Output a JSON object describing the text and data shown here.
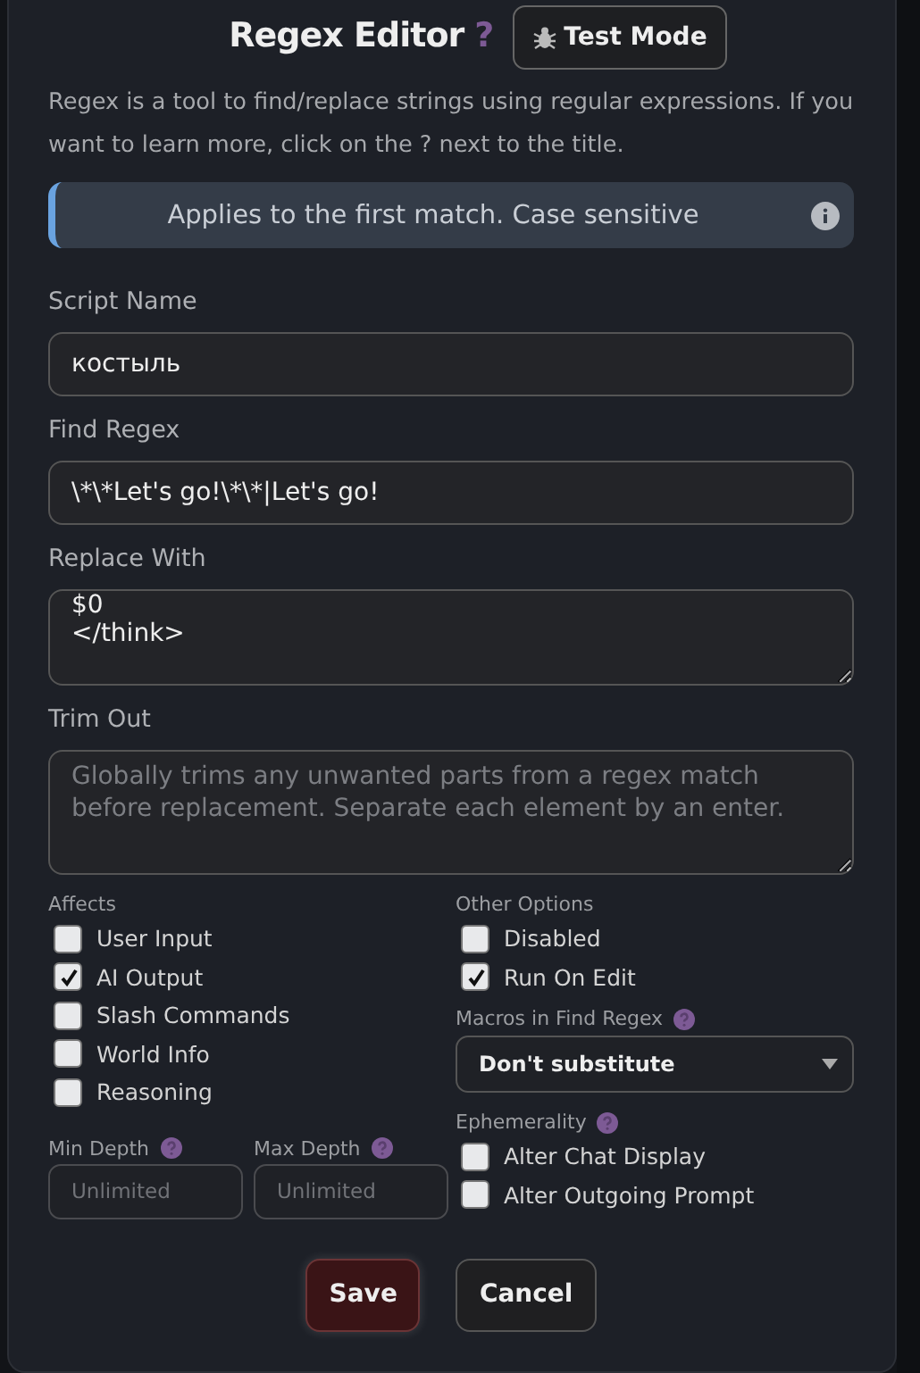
{
  "title": "Regex Editor",
  "help_mark": "?",
  "test_mode": {
    "label": "Test Mode"
  },
  "description": "Regex is a tool to find/replace strings using regular expressions. If you want to learn more, click on the ? next to the title.",
  "info_banner": {
    "text": "Applies to the first match. Case sensitive"
  },
  "fields": [
    {
      "label": "Script Name",
      "kind": "input",
      "value": "костыль"
    },
    {
      "label": "Find Regex",
      "kind": "input",
      "value": "\\*\\*Let's go!\\*\\*|Let's go!"
    },
    {
      "label": "Replace With",
      "kind": "textarea",
      "value": "$0\n</think>"
    },
    {
      "label": "Trim Out",
      "kind": "textarea",
      "placeholder": "Globally trims any unwanted parts from a regex match before replacement. Separate each element by an enter."
    }
  ],
  "affects": {
    "label": "Affects",
    "options": [
      {
        "label": "User Input",
        "checked": false
      },
      {
        "label": "AI Output",
        "checked": true
      },
      {
        "label": "Slash Commands",
        "checked": false
      },
      {
        "label": "World Info",
        "checked": false
      },
      {
        "label": "Reasoning",
        "checked": false
      }
    ]
  },
  "depth": [
    {
      "label": "Min Depth",
      "placeholder": "Unlimited"
    },
    {
      "label": "Max Depth",
      "placeholder": "Unlimited"
    }
  ],
  "other_options": {
    "label": "Other Options",
    "options": [
      {
        "label": "Disabled",
        "checked": false
      },
      {
        "label": "Run On Edit",
        "checked": true
      }
    ]
  },
  "macros": {
    "label": "Macros in Find Regex",
    "value": "Don't substitute"
  },
  "ephemerality": {
    "label": "Ephemerality",
    "options": [
      {
        "label": "Alter Chat Display",
        "checked": false
      },
      {
        "label": "Alter Outgoing Prompt",
        "checked": false
      }
    ]
  },
  "buttons": [
    {
      "label": "Save",
      "kind": "primary"
    },
    {
      "label": "Cancel",
      "kind": "secondary"
    }
  ]
}
